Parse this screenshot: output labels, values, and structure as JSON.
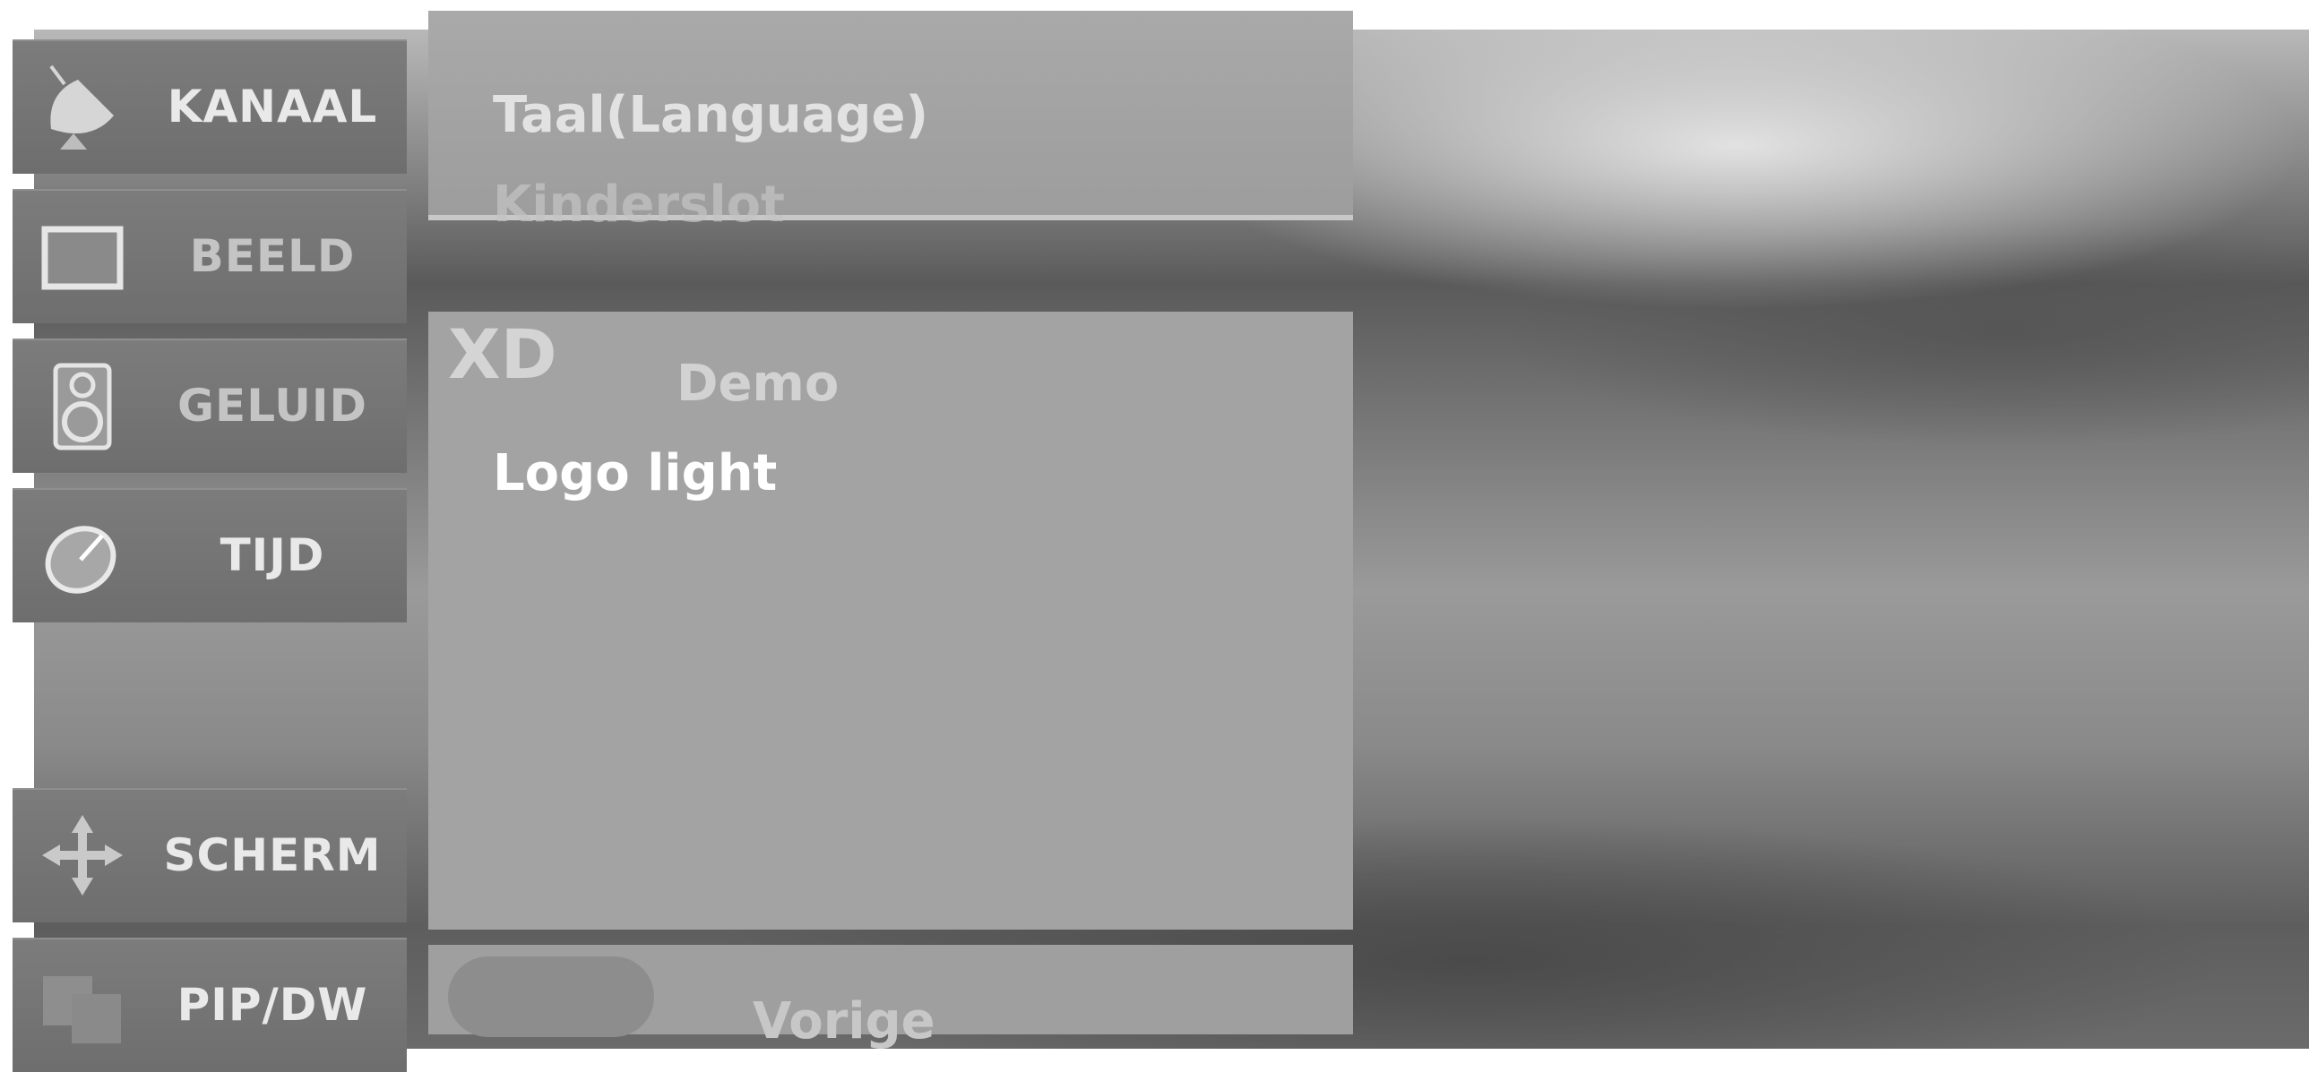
{
  "sidebar": {
    "items": [
      {
        "label": "KANAAL",
        "icon": "satellite-dish-icon"
      },
      {
        "label": "BEELD",
        "icon": "monitor-icon"
      },
      {
        "label": "GELUID",
        "icon": "speaker-icon"
      },
      {
        "label": "TIJD",
        "icon": "clock-icon"
      },
      {
        "label": "SCHERM",
        "icon": "move-arrows-icon"
      },
      {
        "label": "PIP/DW",
        "icon": "pip-windows-icon"
      }
    ]
  },
  "menu": {
    "top_items": [
      "Taal(Language)",
      "Kinderslot"
    ],
    "xd_logo": "XD",
    "main_items": [
      "Demo",
      "Logo light"
    ],
    "selected_item": "Logo light"
  },
  "footer": {
    "back_label": "Vorige"
  },
  "colors": {
    "tab_background": "#757575",
    "panel_background": "#a3a3a3",
    "selected_text": "#ffffff",
    "dim_text": "#d2d2d2"
  }
}
